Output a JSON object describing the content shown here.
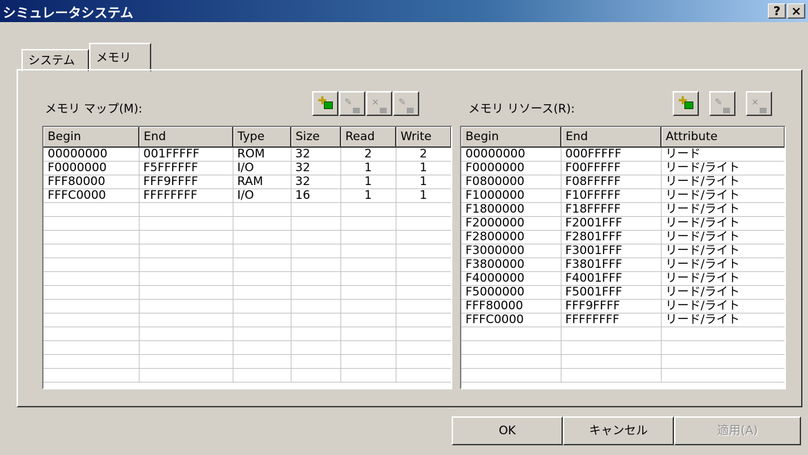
{
  "window": {
    "title": "シミュレータシステム",
    "help": "?",
    "close": "×"
  },
  "tabs": [
    {
      "label": "システム"
    },
    {
      "label": "メモリ",
      "active": true
    }
  ],
  "memory_map": {
    "label": "メモリ マップ(M):",
    "toolbar": [
      "add-icon",
      "edit-icon",
      "delete-icon",
      "modify-icon"
    ],
    "columns": [
      "Begin",
      "End",
      "Type",
      "Size",
      "Read",
      "Write"
    ],
    "rows": [
      [
        "00000000",
        "001FFFFF",
        "ROM",
        "32",
        "2",
        "2"
      ],
      [
        "F0000000",
        "F5FFFFFF",
        "I/O",
        "32",
        "1",
        "1"
      ],
      [
        "FFF80000",
        "FFF9FFFF",
        "RAM",
        "32",
        "1",
        "1"
      ],
      [
        "FFFC0000",
        "FFFFFFFF",
        "I/O",
        "16",
        "1",
        "1"
      ]
    ]
  },
  "memory_resource": {
    "label": "メモリ リソース(R):",
    "toolbar": [
      "add-icon",
      "edit-icon",
      "delete-icon"
    ],
    "columns": [
      "Begin",
      "End",
      "Attribute"
    ],
    "rows": [
      [
        "00000000",
        "000FFFFF",
        "リード"
      ],
      [
        "F0000000",
        "F00FFFFF",
        "リード/ライト"
      ],
      [
        "F0800000",
        "F08FFFFF",
        "リード/ライト"
      ],
      [
        "F1000000",
        "F10FFFFF",
        "リード/ライト"
      ],
      [
        "F1800000",
        "F18FFFFF",
        "リード/ライト"
      ],
      [
        "F2000000",
        "F2001FFF",
        "リード/ライト"
      ],
      [
        "F2800000",
        "F2801FFF",
        "リード/ライト"
      ],
      [
        "F3000000",
        "F3001FFF",
        "リード/ライト"
      ],
      [
        "F3800000",
        "F3801FFF",
        "リード/ライト"
      ],
      [
        "F4000000",
        "F4001FFF",
        "リード/ライト"
      ],
      [
        "F5000000",
        "F5001FFF",
        "リード/ライト"
      ],
      [
        "FFF80000",
        "FFF9FFFF",
        "リード/ライト"
      ],
      [
        "FFFC0000",
        "FFFFFFFF",
        "リード/ライト"
      ]
    ]
  },
  "buttons": {
    "ok": "OK",
    "cancel": "キャンセル",
    "apply": "適用(A)"
  }
}
